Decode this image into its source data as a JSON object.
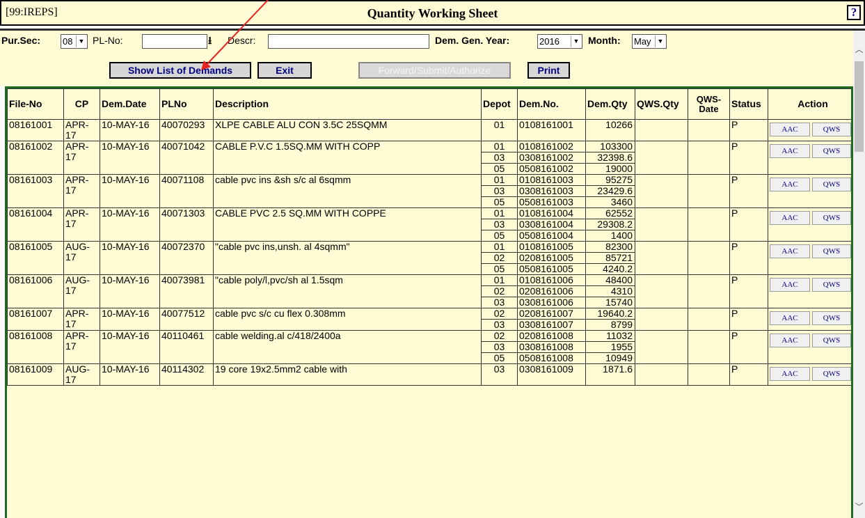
{
  "title_bar": {
    "tag": "[99:IREPS]",
    "title": "Quantity Working Sheet",
    "help": "?"
  },
  "filters": {
    "pursec_label": "Pur.Sec:",
    "pursec_value": "08",
    "plno_label": "PL-No:",
    "plno_value": "",
    "descr_label": "Descr:",
    "descr_value": "",
    "year_label": "Dem. Gen. Year:",
    "year_value": "2016",
    "month_label": "Month:",
    "month_value": "May"
  },
  "buttons": {
    "show_list": "Show List of Demands",
    "exit": "Exit",
    "forward": "Forward/Submit/Authorize",
    "print": "Print"
  },
  "table": {
    "headers": [
      "File-No",
      "CP",
      "Dem.Date",
      "PLNo",
      "Description",
      "Depot",
      "Dem.No.",
      "Dem.Qty",
      "QWS.Qty",
      "QWS-Date",
      "Status",
      "Action"
    ],
    "rows": [
      {
        "file_no": "08161001",
        "cp": "APR-17",
        "date": "10-MAY-16",
        "plno": "40070293",
        "desc": "XLPE CABLE ALU CON 3.5C 25SQMM",
        "status": "P",
        "aac": "AAC",
        "qws": "QWS",
        "depots": [
          {
            "depot": "01",
            "dem_no": "0108161001",
            "qty": "10266"
          }
        ]
      },
      {
        "file_no": "08161002",
        "cp": "APR-17",
        "date": "10-MAY-16",
        "plno": "40071042",
        "desc": "CABLE P.V.C 1.5SQ.MM WITH COPP",
        "status": "P",
        "aac": "AAC",
        "qws": "QWS",
        "depots": [
          {
            "depot": "01",
            "dem_no": "0108161002",
            "qty": "103300"
          },
          {
            "depot": "03",
            "dem_no": "0308161002",
            "qty": "32398.6"
          },
          {
            "depot": "05",
            "dem_no": "0508161002",
            "qty": "19000"
          }
        ]
      },
      {
        "file_no": "08161003",
        "cp": "APR-17",
        "date": "10-MAY-16",
        "plno": "40071108",
        "desc": "cable pvc ins &sh s/c al 6sqmm",
        "status": "P",
        "aac": "AAC",
        "qws": "QWS",
        "depots": [
          {
            "depot": "01",
            "dem_no": "0108161003",
            "qty": "95275"
          },
          {
            "depot": "03",
            "dem_no": "0308161003",
            "qty": "23429.6"
          },
          {
            "depot": "05",
            "dem_no": "0508161003",
            "qty": "3460"
          }
        ]
      },
      {
        "file_no": "08161004",
        "cp": "APR-17",
        "date": "10-MAY-16",
        "plno": "40071303",
        "desc": "CABLE PVC 2.5 SQ.MM WITH COPPE",
        "status": "P",
        "aac": "AAC",
        "qws": "QWS",
        "depots": [
          {
            "depot": "01",
            "dem_no": "0108161004",
            "qty": "62552"
          },
          {
            "depot": "03",
            "dem_no": "0308161004",
            "qty": "29308.2"
          },
          {
            "depot": "05",
            "dem_no": "0508161004",
            "qty": "1400"
          }
        ]
      },
      {
        "file_no": "08161005",
        "cp": "AUG-17",
        "date": "10-MAY-16",
        "plno": "40072370",
        "desc": "\"cable pvc ins,unsh. al 4sqmm\"",
        "status": "P",
        "aac": "AAC",
        "qws": "QWS",
        "depots": [
          {
            "depot": "01",
            "dem_no": "0108161005",
            "qty": "82300"
          },
          {
            "depot": "02",
            "dem_no": "0208161005",
            "qty": "85721"
          },
          {
            "depot": "05",
            "dem_no": "0508161005",
            "qty": "4240.2"
          }
        ]
      },
      {
        "file_no": "08161006",
        "cp": "AUG-17",
        "date": "10-MAY-16",
        "plno": "40073981",
        "desc": "\"cable poly/l,pvc/sh al 1.5sqm",
        "status": "P",
        "aac": "AAC",
        "qws": "QWS",
        "depots": [
          {
            "depot": "01",
            "dem_no": "0108161006",
            "qty": "48400"
          },
          {
            "depot": "02",
            "dem_no": "0208161006",
            "qty": "4310"
          },
          {
            "depot": "03",
            "dem_no": "0308161006",
            "qty": "15740"
          }
        ]
      },
      {
        "file_no": "08161007",
        "cp": "APR-17",
        "date": "10-MAY-16",
        "plno": "40077512",
        "desc": "cable pvc s/c cu flex 0.308mm",
        "status": "P",
        "aac": "AAC",
        "qws": "QWS",
        "depots": [
          {
            "depot": "02",
            "dem_no": "0208161007",
            "qty": "19640.2"
          },
          {
            "depot": "03",
            "dem_no": "0308161007",
            "qty": "8799"
          }
        ]
      },
      {
        "file_no": "08161008",
        "cp": "APR-17",
        "date": "10-MAY-16",
        "plno": "40110461",
        "desc": "cable welding.al c/418/2400a",
        "status": "P",
        "aac": "AAC",
        "qws": "QWS",
        "depots": [
          {
            "depot": "02",
            "dem_no": "0208161008",
            "qty": "11032"
          },
          {
            "depot": "03",
            "dem_no": "0308161008",
            "qty": "1955"
          },
          {
            "depot": "05",
            "dem_no": "0508161008",
            "qty": "10949"
          }
        ]
      },
      {
        "file_no": "08161009",
        "cp": "AUG-17",
        "date": "10-MAY-16",
        "plno": "40114302",
        "desc": "19 core 19x2.5mm2 cable with",
        "status": "P",
        "aac": "AAC",
        "qws": "QWS",
        "depots": [
          {
            "depot": "03",
            "dem_no": "0308161009",
            "qty": "1871.6"
          }
        ]
      }
    ]
  },
  "colors": {
    "panel_bg": "#fffbd5",
    "table_border": "#1f6b1f",
    "button_text": "#000080",
    "annotation_arrow": "#e8231f"
  }
}
